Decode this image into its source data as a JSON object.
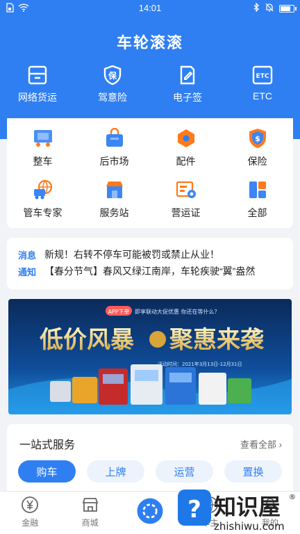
{
  "status_bar": {
    "time": "14:01",
    "battery_level": 0.85
  },
  "header": {
    "title": "车轮滚滚"
  },
  "main_menu": [
    {
      "label": "网络货运",
      "icon": "freight-icon"
    },
    {
      "label": "驾意险",
      "icon": "insurance-shield-icon"
    },
    {
      "label": "电子签",
      "icon": "e-sign-icon"
    },
    {
      "label": "ETC",
      "icon": "etc-icon"
    }
  ],
  "services_grid": [
    {
      "label": "整车",
      "icon": "truck-icon"
    },
    {
      "label": "后市场",
      "icon": "shopping-bag-icon"
    },
    {
      "label": "配件",
      "icon": "parts-hexagon-icon"
    },
    {
      "label": "保险",
      "icon": "insurance-icon"
    },
    {
      "label": "管车专家",
      "icon": "fleet-globe-icon"
    },
    {
      "label": "服务站",
      "icon": "service-station-icon"
    },
    {
      "label": "营运证",
      "icon": "license-icon"
    },
    {
      "label": "全部",
      "icon": "all-apps-icon"
    }
  ],
  "notices": {
    "tag_line1": "消息",
    "tag_line2": "通知",
    "items": [
      "新规！右转不停车可能被罚或禁止从业！",
      "【春分节气】春风又绿江南岸，车轮疾驶“翼”盎然"
    ]
  },
  "banner": {
    "badge": "APP下单",
    "subtitle": "即享联动大促优惠  你还在等什么？",
    "headline_left": "低价风暴",
    "headline_right": "聚惠来袭",
    "date_text": "活动时间：2021年3月13日-12月31日"
  },
  "service_section": {
    "title": "一站式服务",
    "more_label": "查看全部",
    "tabs": [
      "购车",
      "上牌",
      "运营",
      "置换"
    ],
    "active_tab": "购车"
  },
  "tab_bar": [
    {
      "label": "金融",
      "icon": "yen-icon"
    },
    {
      "label": "商城",
      "icon": "store-icon"
    },
    {
      "label": "",
      "icon": "center-logo-icon"
    },
    {
      "label": "车主",
      "icon": "globe-icon"
    },
    {
      "label": "我的",
      "icon": "profile-icon"
    }
  ],
  "watermark": {
    "text_cn": "知识屋",
    "text_en": "zhishiwu.com",
    "registered": "®"
  },
  "colors": {
    "primary": "#2f7ff2",
    "orange": "#ff7a1a",
    "background": "#f2f3f7"
  }
}
